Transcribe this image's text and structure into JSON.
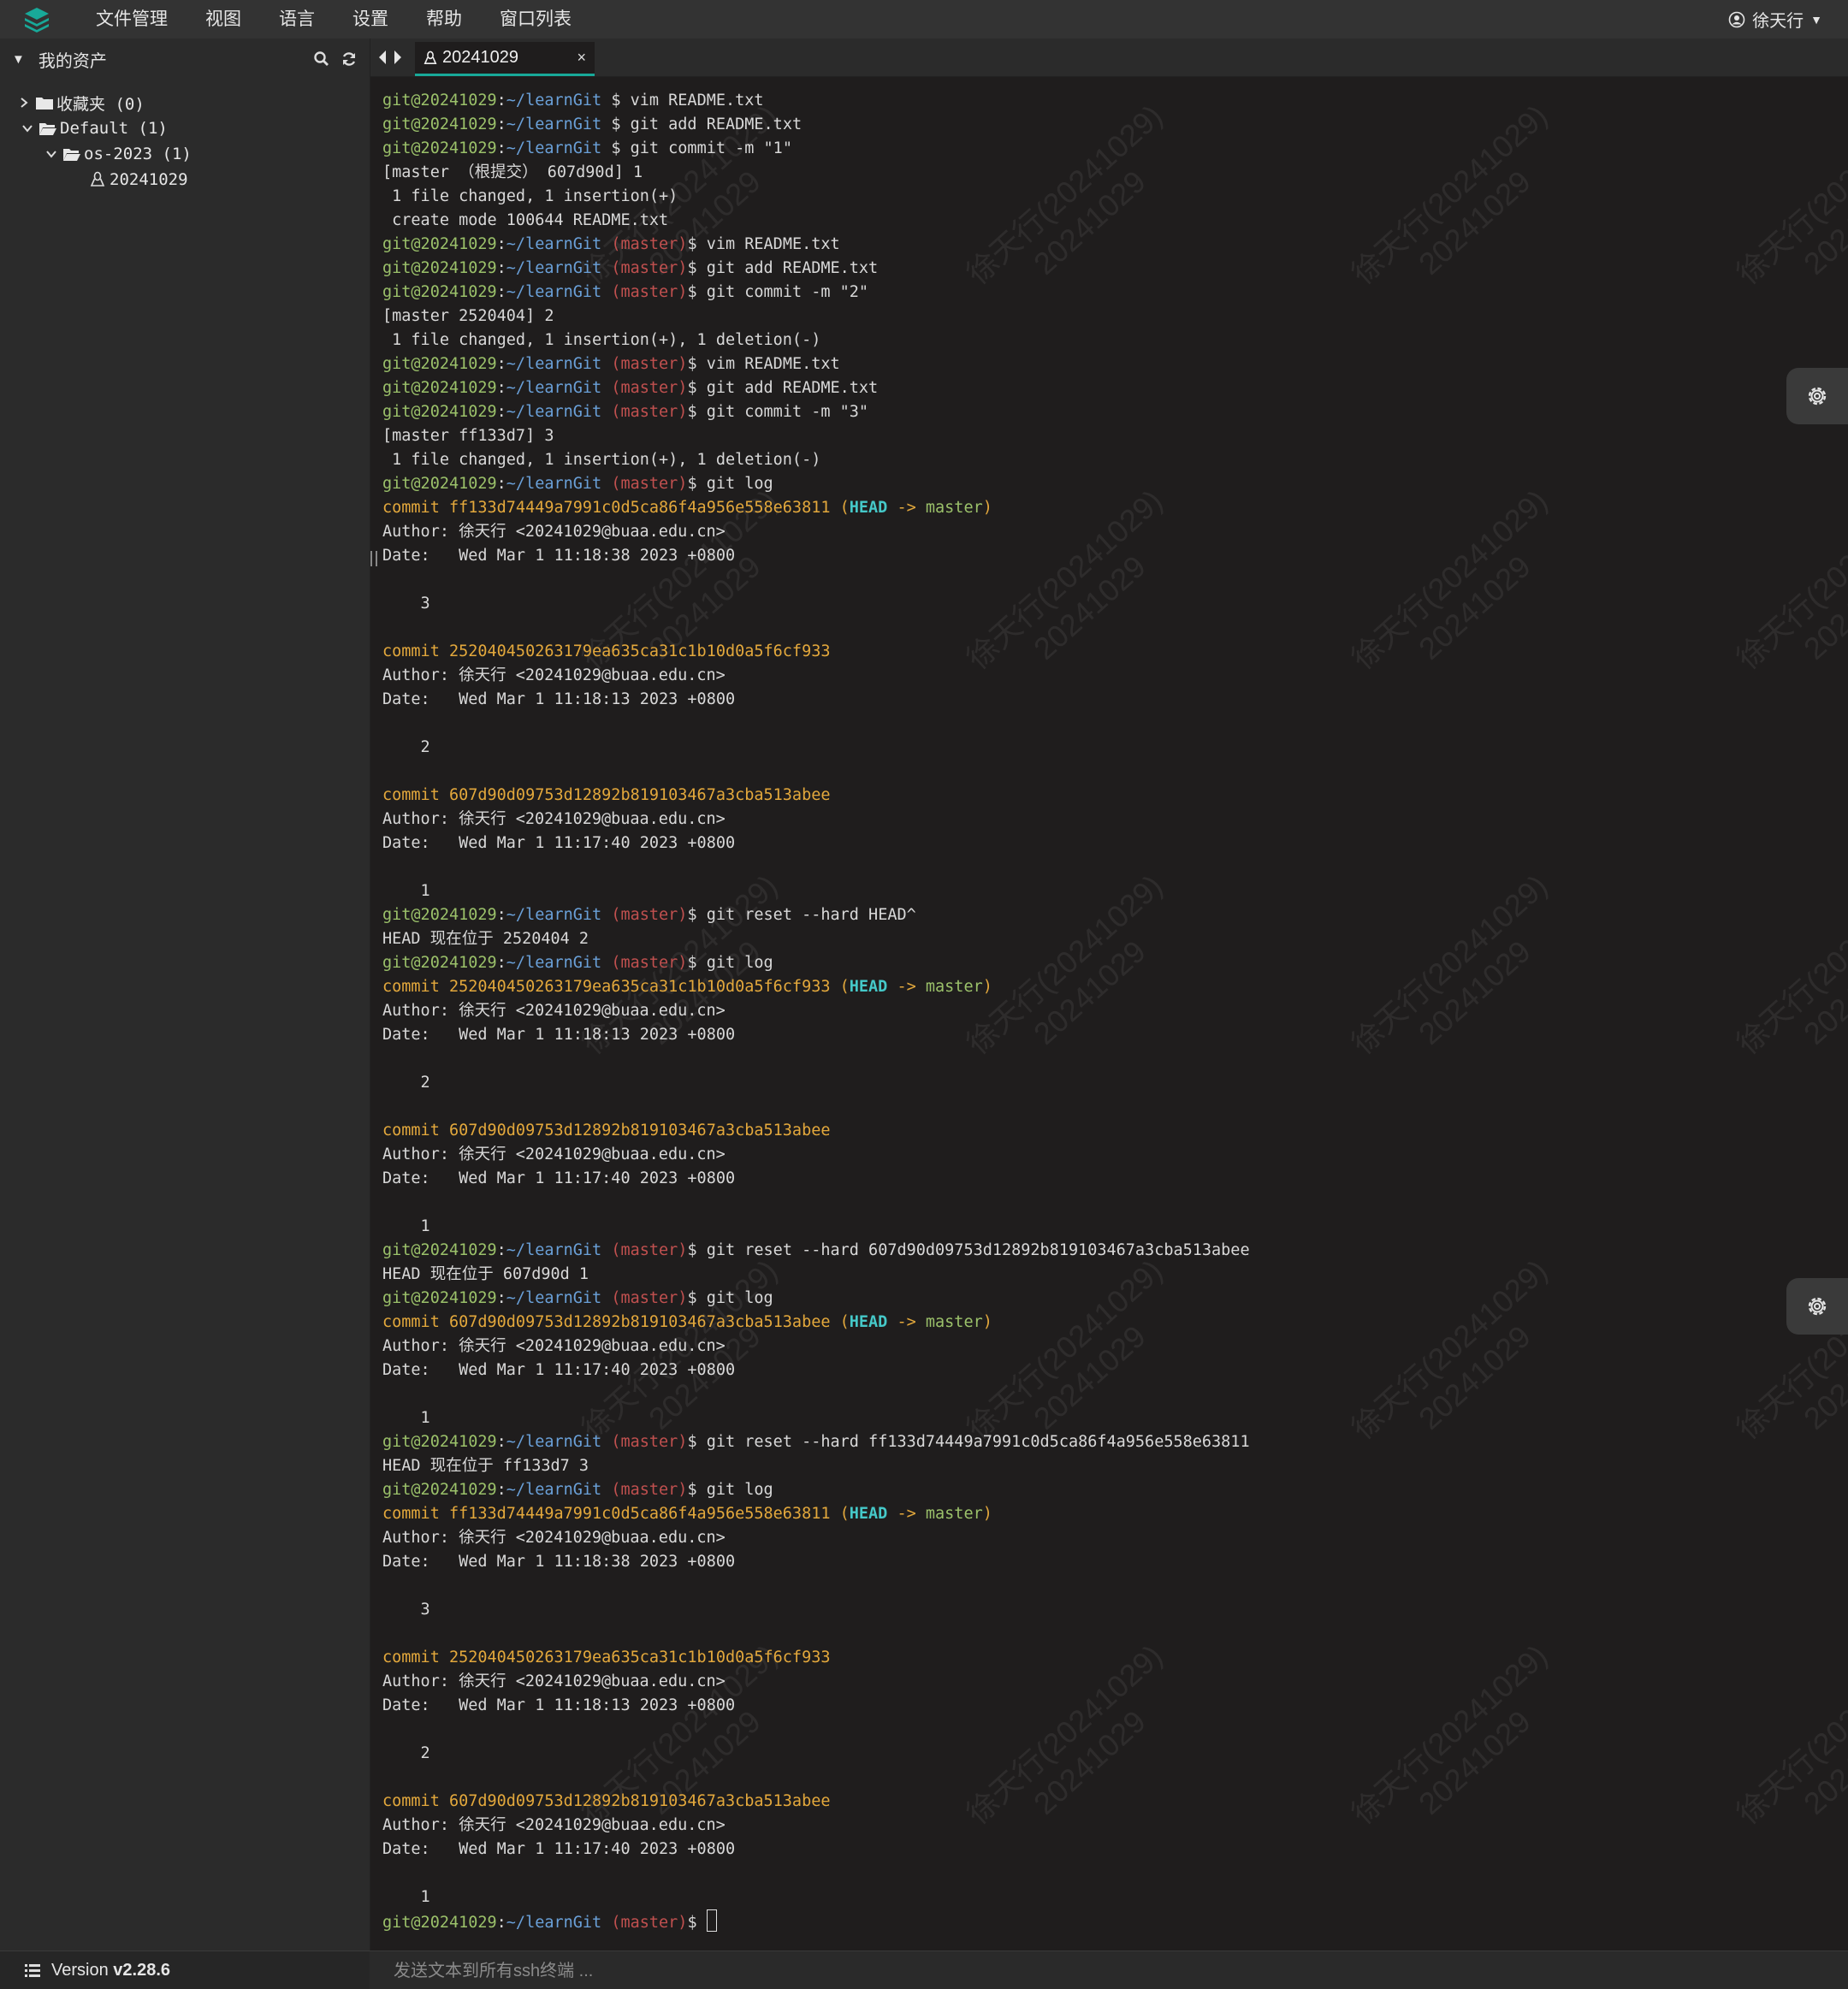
{
  "menu": [
    "文件管理",
    "视图",
    "语言",
    "设置",
    "帮助",
    "窗口列表"
  ],
  "user": {
    "name": "徐天行"
  },
  "sidebar": {
    "title": "我的资产",
    "tree": [
      {
        "label": "收藏夹 (0)",
        "level": 0,
        "expanded": false,
        "icon": "folder-icon"
      },
      {
        "label": "Default (1)",
        "level": 0,
        "expanded": true,
        "icon": "folder-open-icon"
      },
      {
        "label": "os-2023 (1)",
        "level": 1,
        "expanded": true,
        "icon": "folder-open-icon"
      },
      {
        "label": "20241029",
        "level": 2,
        "icon": "linux-icon"
      }
    ]
  },
  "tab": {
    "title": "20241029",
    "close": "×"
  },
  "status": {
    "version_prefix": "Version",
    "version": "v2.28.6"
  },
  "broadcast": {
    "placeholder": "发送文本到所有ssh终端 ..."
  },
  "watermark": {
    "line1": "徐天行(20241029)",
    "line2": "20241029"
  },
  "prompt": {
    "user": "git@20241029",
    "colon": ":",
    "path": "~/learnGit",
    "branch": "(master)",
    "sign": "$"
  },
  "terminal_lines": [
    {
      "t": "prompt",
      "branch": false,
      "cmd": " vim README.txt"
    },
    {
      "t": "prompt",
      "branch": false,
      "cmd": " git add README.txt"
    },
    {
      "t": "prompt",
      "branch": false,
      "cmd": " git commit -m \"1\""
    },
    {
      "t": "out",
      "text": "[master （根提交） 607d90d] 1"
    },
    {
      "t": "out",
      "text": " 1 file changed, 1 insertion(+)"
    },
    {
      "t": "out",
      "text": " create mode 100644 README.txt"
    },
    {
      "t": "prompt",
      "branch": true,
      "cmd": " vim README.txt"
    },
    {
      "t": "prompt",
      "branch": true,
      "cmd": " git add README.txt"
    },
    {
      "t": "prompt",
      "branch": true,
      "cmd": " git commit -m \"2\""
    },
    {
      "t": "out",
      "text": "[master 2520404] 2"
    },
    {
      "t": "out",
      "text": " 1 file changed, 1 insertion(+), 1 deletion(-)"
    },
    {
      "t": "prompt",
      "branch": true,
      "cmd": " vim README.txt"
    },
    {
      "t": "prompt",
      "branch": true,
      "cmd": " git add README.txt"
    },
    {
      "t": "prompt",
      "branch": true,
      "cmd": " git commit -m \"3\""
    },
    {
      "t": "out",
      "text": "[master ff133d7] 3"
    },
    {
      "t": "out",
      "text": " 1 file changed, 1 insertion(+), 1 deletion(-)"
    },
    {
      "t": "prompt",
      "branch": true,
      "cmd": " git log"
    },
    {
      "t": "commit",
      "hash": "commit ff133d74449a7991c0d5ca86f4a956e558e63811",
      "head": true
    },
    {
      "t": "out",
      "text": "Author: 徐天行 <20241029@buaa.edu.cn>"
    },
    {
      "t": "out",
      "text": "Date:   Wed Mar 1 11:18:38 2023 +0800"
    },
    {
      "t": "out",
      "text": ""
    },
    {
      "t": "out",
      "text": "    3"
    },
    {
      "t": "out",
      "text": ""
    },
    {
      "t": "commit",
      "hash": "commit 252040450263179ea635ca31c1b10d0a5f6cf933",
      "head": false
    },
    {
      "t": "out",
      "text": "Author: 徐天行 <20241029@buaa.edu.cn>"
    },
    {
      "t": "out",
      "text": "Date:   Wed Mar 1 11:18:13 2023 +0800"
    },
    {
      "t": "out",
      "text": ""
    },
    {
      "t": "out",
      "text": "    2"
    },
    {
      "t": "out",
      "text": ""
    },
    {
      "t": "commit",
      "hash": "commit 607d90d09753d12892b819103467a3cba513abee",
      "head": false
    },
    {
      "t": "out",
      "text": "Author: 徐天行 <20241029@buaa.edu.cn>"
    },
    {
      "t": "out",
      "text": "Date:   Wed Mar 1 11:17:40 2023 +0800"
    },
    {
      "t": "out",
      "text": ""
    },
    {
      "t": "out",
      "text": "    1"
    },
    {
      "t": "prompt",
      "branch": true,
      "cmd": " git reset --hard HEAD^"
    },
    {
      "t": "out",
      "text": "HEAD 现在位于 2520404 2"
    },
    {
      "t": "prompt",
      "branch": true,
      "cmd": " git log"
    },
    {
      "t": "commit",
      "hash": "commit 252040450263179ea635ca31c1b10d0a5f6cf933",
      "head": true
    },
    {
      "t": "out",
      "text": "Author: 徐天行 <20241029@buaa.edu.cn>"
    },
    {
      "t": "out",
      "text": "Date:   Wed Mar 1 11:18:13 2023 +0800"
    },
    {
      "t": "out",
      "text": ""
    },
    {
      "t": "out",
      "text": "    2"
    },
    {
      "t": "out",
      "text": ""
    },
    {
      "t": "commit",
      "hash": "commit 607d90d09753d12892b819103467a3cba513abee",
      "head": false
    },
    {
      "t": "out",
      "text": "Author: 徐天行 <20241029@buaa.edu.cn>"
    },
    {
      "t": "out",
      "text": "Date:   Wed Mar 1 11:17:40 2023 +0800"
    },
    {
      "t": "out",
      "text": ""
    },
    {
      "t": "out",
      "text": "    1"
    },
    {
      "t": "prompt",
      "branch": true,
      "cmd": " git reset --hard 607d90d09753d12892b819103467a3cba513abee"
    },
    {
      "t": "out",
      "text": "HEAD 现在位于 607d90d 1"
    },
    {
      "t": "prompt",
      "branch": true,
      "cmd": " git log"
    },
    {
      "t": "commit",
      "hash": "commit 607d90d09753d12892b819103467a3cba513abee",
      "head": true
    },
    {
      "t": "out",
      "text": "Author: 徐天行 <20241029@buaa.edu.cn>"
    },
    {
      "t": "out",
      "text": "Date:   Wed Mar 1 11:17:40 2023 +0800"
    },
    {
      "t": "out",
      "text": ""
    },
    {
      "t": "out",
      "text": "    1"
    },
    {
      "t": "prompt",
      "branch": true,
      "cmd": " git reset --hard ff133d74449a7991c0d5ca86f4a956e558e63811"
    },
    {
      "t": "out",
      "text": "HEAD 现在位于 ff133d7 3"
    },
    {
      "t": "prompt",
      "branch": true,
      "cmd": " git log"
    },
    {
      "t": "commit",
      "hash": "commit ff133d74449a7991c0d5ca86f4a956e558e63811",
      "head": true
    },
    {
      "t": "out",
      "text": "Author: 徐天行 <20241029@buaa.edu.cn>"
    },
    {
      "t": "out",
      "text": "Date:   Wed Mar 1 11:18:38 2023 +0800"
    },
    {
      "t": "out",
      "text": ""
    },
    {
      "t": "out",
      "text": "    3"
    },
    {
      "t": "out",
      "text": ""
    },
    {
      "t": "commit",
      "hash": "commit 252040450263179ea635ca31c1b10d0a5f6cf933",
      "head": false
    },
    {
      "t": "out",
      "text": "Author: 徐天行 <20241029@buaa.edu.cn>"
    },
    {
      "t": "out",
      "text": "Date:   Wed Mar 1 11:18:13 2023 +0800"
    },
    {
      "t": "out",
      "text": ""
    },
    {
      "t": "out",
      "text": "    2"
    },
    {
      "t": "out",
      "text": ""
    },
    {
      "t": "commit",
      "hash": "commit 607d90d09753d12892b819103467a3cba513abee",
      "head": false
    },
    {
      "t": "out",
      "text": "Author: 徐天行 <20241029@buaa.edu.cn>"
    },
    {
      "t": "out",
      "text": "Date:   Wed Mar 1 11:17:40 2023 +0800"
    },
    {
      "t": "out",
      "text": ""
    },
    {
      "t": "out",
      "text": "    1"
    },
    {
      "t": "prompt",
      "branch": true,
      "cmd": " ",
      "cursor": true
    }
  ],
  "head_ref": {
    "open": " (",
    "head": "HEAD",
    "arrow": " -> ",
    "branch": "master",
    "close": ")"
  },
  "colors": {
    "accent": "#18a999",
    "prompt_user": "#9bc16a",
    "prompt_path": "#6aa0d8",
    "prompt_branch": "#c0504f",
    "commit": "#e3a83c",
    "head": "#45c8c8"
  }
}
